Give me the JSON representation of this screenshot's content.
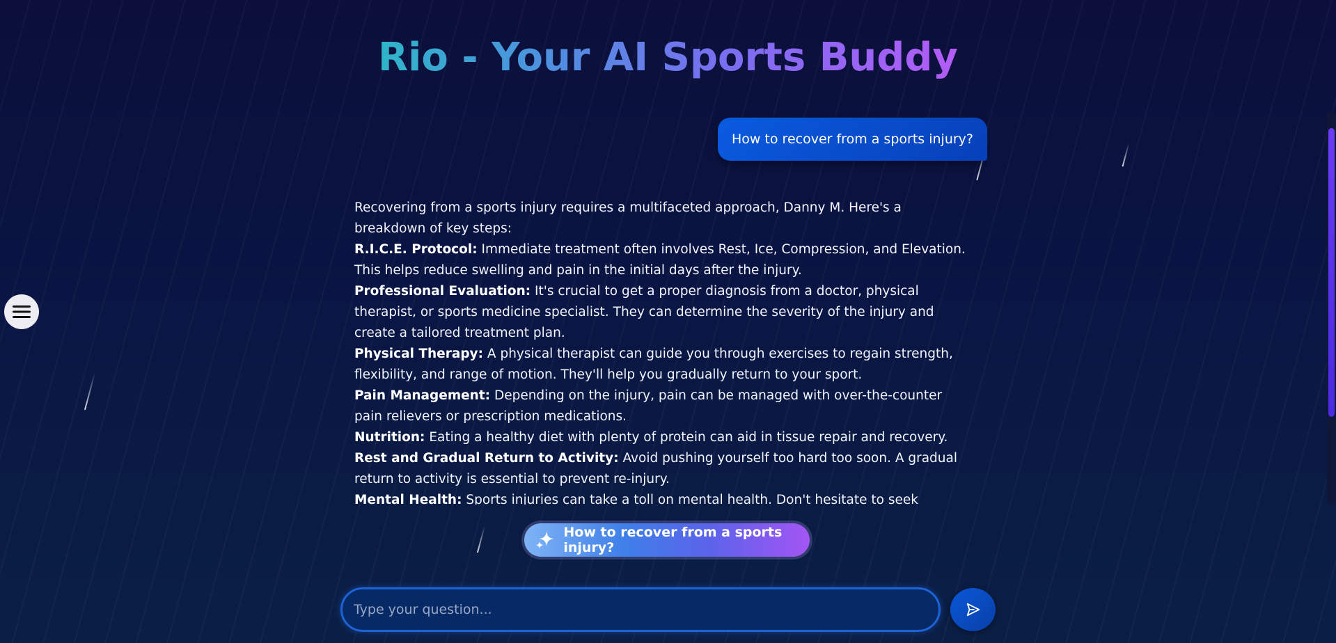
{
  "app": {
    "title": "Rio - Your AI Sports Buddy"
  },
  "colors": {
    "title_gradient": [
      "#2fb5c8",
      "#4f8fe0",
      "#7a6ef0",
      "#b35cf6"
    ],
    "user_bubble": "#0a5be0",
    "accent": "#6a3cf0",
    "background": "#0b0f3a"
  },
  "chat": {
    "user_message": "How to recover from a sports injury?",
    "answer": {
      "intro": "Recovering from a sports injury requires a multifaceted approach, Danny M. Here's a breakdown of key steps:",
      "items": [
        {
          "label": "R.I.C.E. Protocol:",
          "text": " Immediate treatment often involves Rest, Ice, Compression, and Elevation. This helps reduce swelling and pain in the initial days after the injury."
        },
        {
          "label": "Professional Evaluation:",
          "text": " It's crucial to get a proper diagnosis from a doctor, physical therapist, or sports medicine specialist. They can determine the severity of the injury and create a tailored treatment plan."
        },
        {
          "label": "Physical Therapy:",
          "text": " A physical therapist can guide you through exercises to regain strength, flexibility, and range of motion. They'll help you gradually return to your sport."
        },
        {
          "label": "Pain Management:",
          "text": " Depending on the injury, pain can be managed with over-the-counter pain relievers or prescription medications."
        },
        {
          "label": "Nutrition:",
          "text": " Eating a healthy diet with plenty of protein can aid in tissue repair and recovery."
        },
        {
          "label": "Rest and Gradual Return to Activity:",
          "text": " Avoid pushing yourself too hard too soon. A gradual return to activity is essential to prevent re-injury."
        },
        {
          "label": "Mental Health:",
          "text": " Sports injuries can take a toll on mental health. Don't hesitate to seek support from"
        }
      ]
    }
  },
  "suggestion": {
    "icon": "sparkle-icon",
    "label": "How to recover from a sports injury?"
  },
  "composer": {
    "placeholder": "Type your question...",
    "send_icon": "send-icon"
  },
  "menu": {
    "icon": "hamburger-icon"
  }
}
